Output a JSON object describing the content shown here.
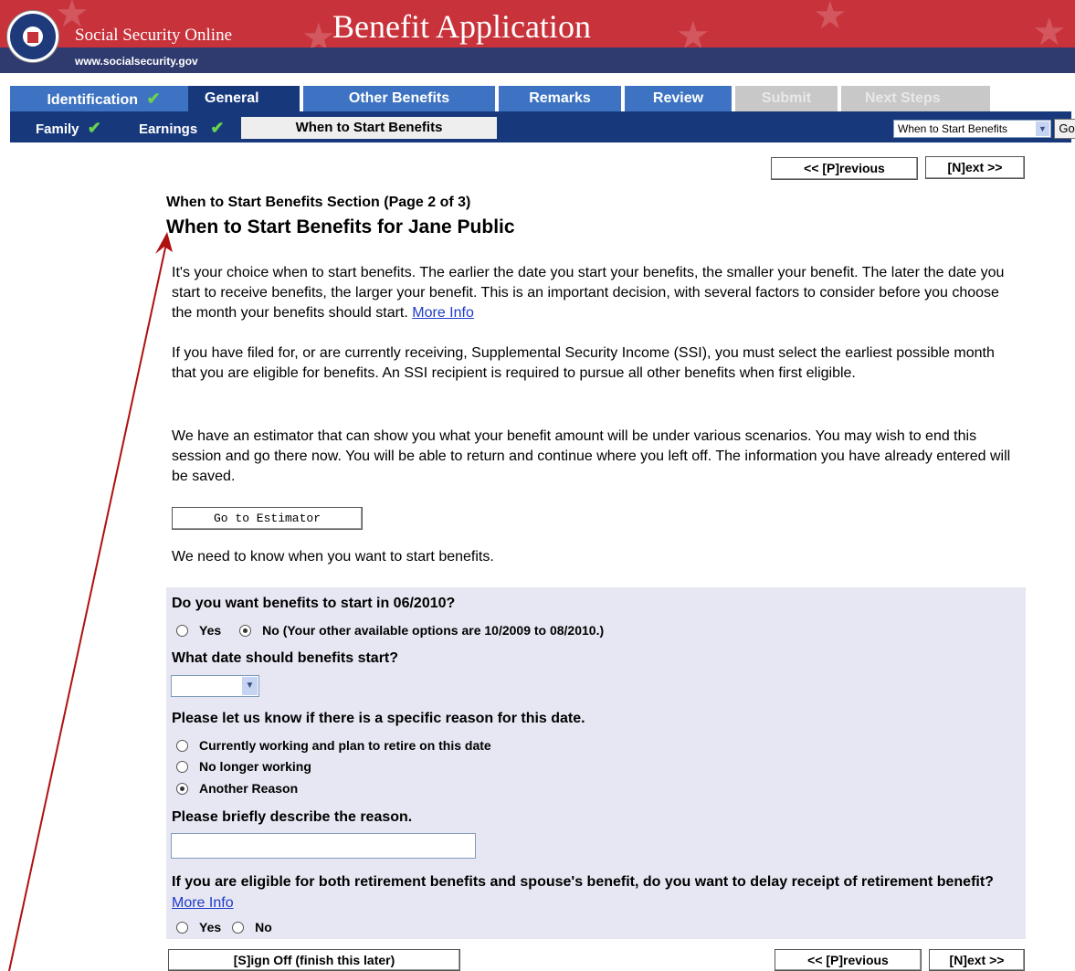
{
  "header": {
    "site_name": "Social Security Online",
    "site_url": "www.socialsecurity.gov",
    "app_title": "Benefit Application"
  },
  "tabs": [
    {
      "label": "Identification",
      "state": "complete"
    },
    {
      "label": "General",
      "state": "active"
    },
    {
      "label": "Other Benefits",
      "state": "pending"
    },
    {
      "label": "Remarks",
      "state": "pending"
    },
    {
      "label": "Review",
      "state": "pending"
    },
    {
      "label": "Submit",
      "state": "disabled"
    },
    {
      "label": "Next Steps",
      "state": "disabled"
    }
  ],
  "subnav": {
    "items": [
      {
        "label": "Family",
        "complete": true
      },
      {
        "label": "Earnings",
        "complete": true
      },
      {
        "label": "When to Start Benefits",
        "active": true
      }
    ],
    "jump_select_value": "When to Start Benefits",
    "go_label": "Go"
  },
  "nav": {
    "previous_label": "<< [P]revious",
    "next_label": "[N]ext >>",
    "signoff_label": "[S]ign Off (finish this later)"
  },
  "content": {
    "section_caption": "When to Start Benefits Section (Page 2 of 3)",
    "page_title": "When to Start Benefits for Jane Public",
    "para1": "It's your choice when to start benefits. The earlier the date you start your benefits, the smaller your benefit. The later the date you start to receive benefits, the larger your benefit. This is an important decision, with several factors to consider before you choose the month your benefits should start.",
    "para1_link": "More Info",
    "para2": "If you have filed for, or are currently receiving, Supplemental Security Income (SSI), you must select the earliest possible month that you are eligible for benefits. An SSI recipient is required to pursue all other benefits when first eligible.",
    "para3": "We have an estimator that can show you what your benefit amount will be under various scenarios. You may wish to end this session and go there now. You will be able to return and continue where you left off. The information you have already entered will be saved.",
    "estimator_button": "Go to Estimator",
    "need_text": "We need to know when you want to start benefits."
  },
  "questions": {
    "q1": "Do you want benefits to start in 06/2010?",
    "q1_yes": "Yes",
    "q1_no": "No (Your other available options are 10/2009 to 08/2010.)",
    "q1_selected": "No",
    "q2": "What date should benefits start?",
    "q2_value": "",
    "q3": "Please let us know if there is a specific reason for this date.",
    "q3_options": [
      "Currently working and plan to retire on this date",
      "No longer working",
      "Another Reason"
    ],
    "q3_selected": "Another Reason",
    "q4": "Please briefly describe the reason.",
    "q4_value": "",
    "q5": "If you are eligible for both retirement benefits and spouse's benefit, do you want to delay receipt of retirement benefit?",
    "q5_link": "More Info",
    "q5_yes": "Yes",
    "q5_no": "No"
  },
  "colors": {
    "banner_red": "#c8323b",
    "banner_navy": "#2f3a6e",
    "tab_blue": "#3d73c2",
    "tab_active": "#17397c",
    "panel_bg": "#e7e7f3",
    "annotation_arrow": "#b01010"
  }
}
